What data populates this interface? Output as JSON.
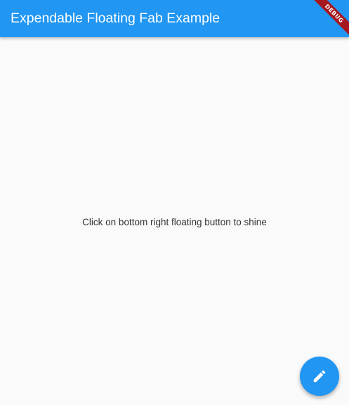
{
  "app_bar": {
    "title": "Expendable Floating Fab Example",
    "color": "#2196f3"
  },
  "debug_banner": {
    "label": "DEBUG",
    "color": "#a6171f"
  },
  "body": {
    "message": "Click on bottom right floating button to shine"
  },
  "fab": {
    "icon": "edit-icon",
    "color": "#2196f3"
  }
}
